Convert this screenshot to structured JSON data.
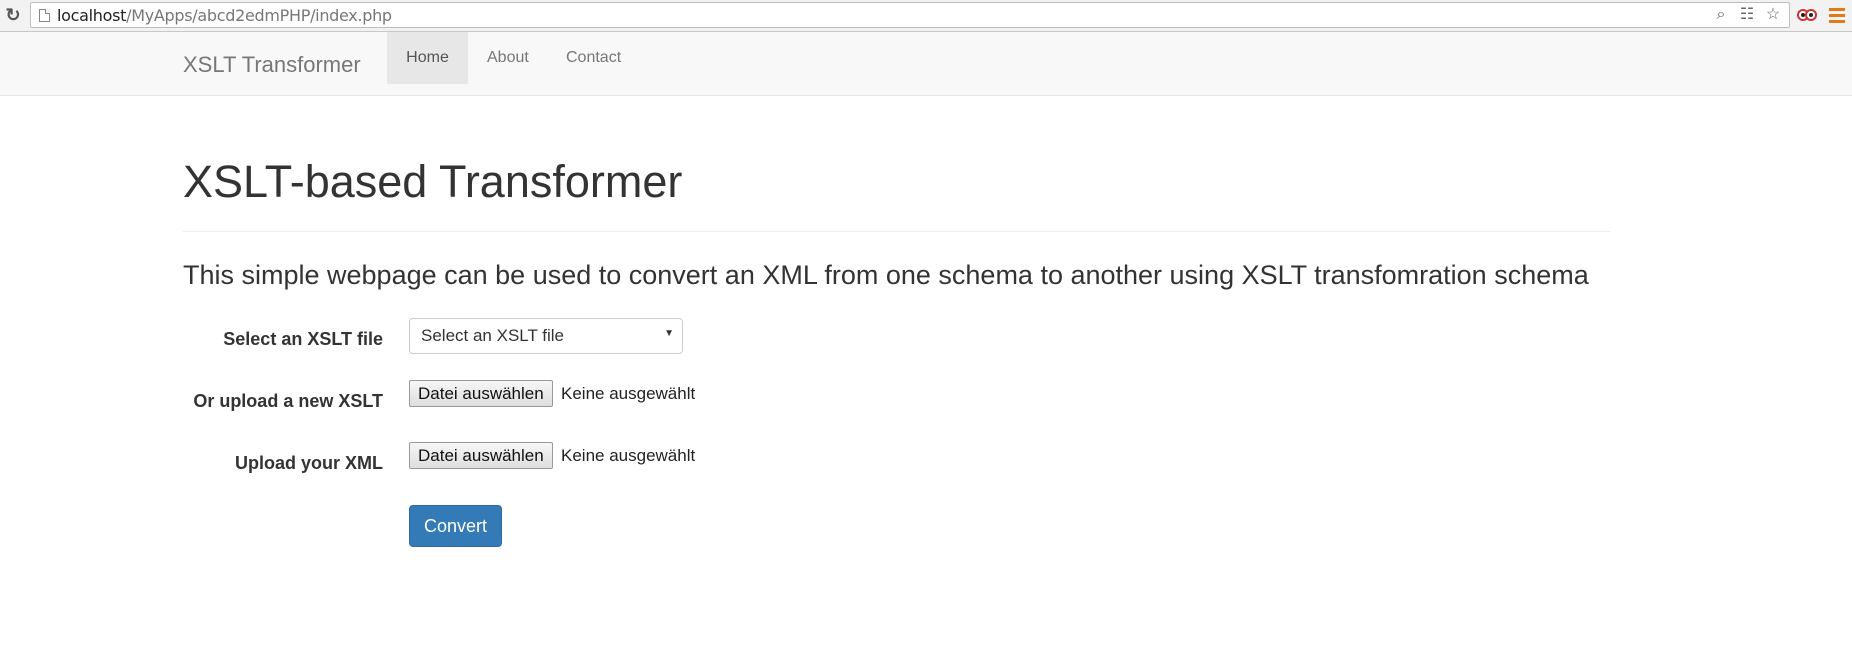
{
  "browser": {
    "url_host": "localhost",
    "url_path": "/MyApps/abcd2edmPHP/index.php",
    "icons": [
      "reload-icon",
      "page-icon",
      "zoom-icon",
      "translate-icon",
      "star-icon",
      "extension-icon",
      "menu-icon"
    ]
  },
  "navbar": {
    "brand": "XSLT Transformer",
    "items": [
      {
        "label": "Home",
        "active": true
      },
      {
        "label": "About",
        "active": false
      },
      {
        "label": "Contact",
        "active": false
      }
    ]
  },
  "main": {
    "title": "XSLT-based Transformer",
    "lead": "This simple webpage can be used to convert an XML from one schema to another using XSLT transfomration schema"
  },
  "form": {
    "select_label": "Select an XSLT file",
    "select_value": "Select an XSLT file",
    "upload_xslt_label": "Or upload a new XSLT",
    "upload_xml_label": "Upload your XML",
    "file_button_label": "Datei auswählen",
    "file_status": "Keine ausgewählt",
    "convert_label": "Convert"
  },
  "colors": {
    "primary": "#337ab7",
    "navbar_bg": "#f8f8f8",
    "nav_active_bg": "#e7e7e7",
    "menu_icon": "#e07b1a"
  }
}
